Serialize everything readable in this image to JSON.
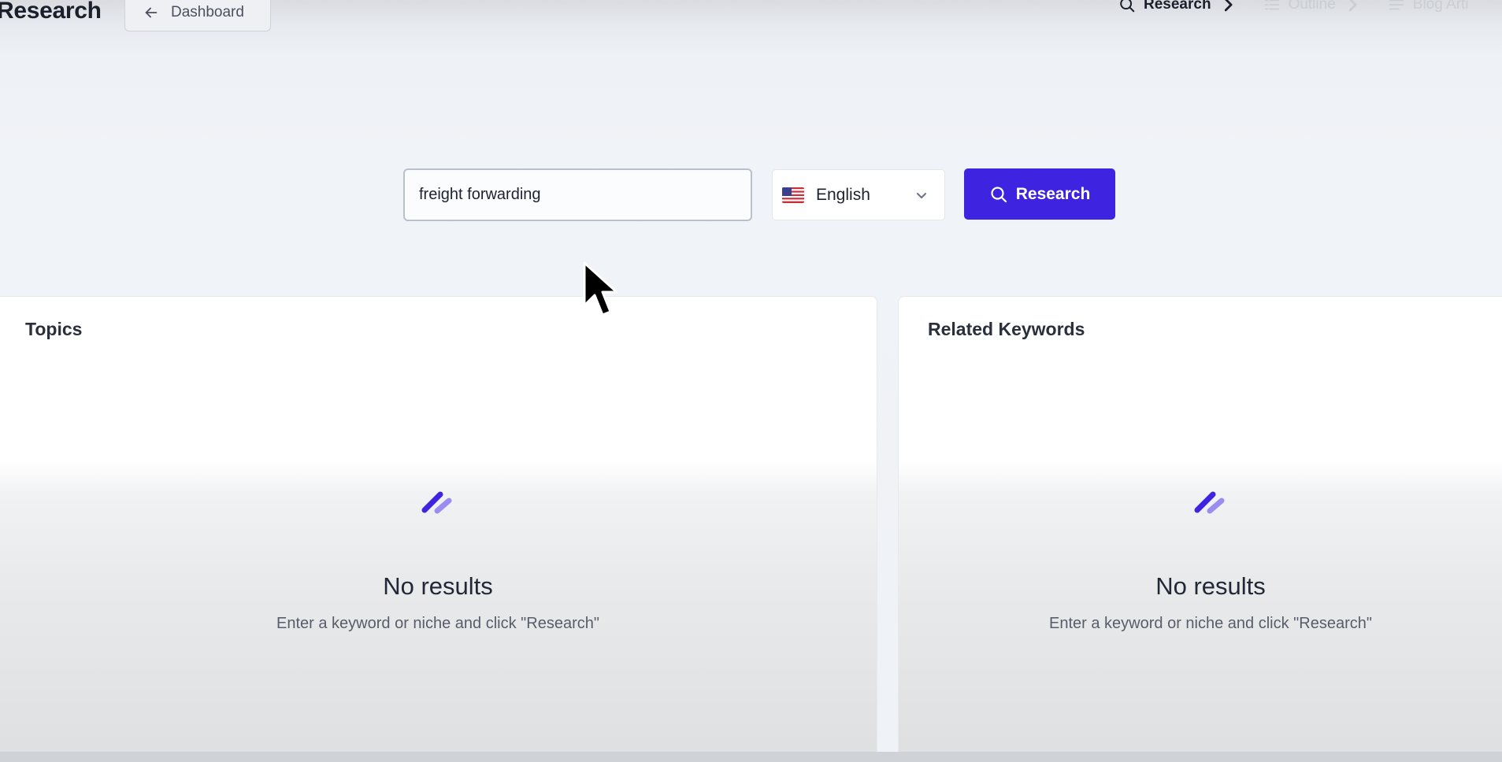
{
  "header": {
    "title": "Research",
    "back_label": "Dashboard",
    "steps": [
      {
        "label": "Research",
        "icon": "search-icon",
        "state": "active"
      },
      {
        "label": "Outline",
        "icon": "list-icon",
        "state": "inactive"
      },
      {
        "label": "Blog Arti",
        "icon": "menu-icon",
        "state": "inactive"
      }
    ]
  },
  "search": {
    "value": "freight forwarding",
    "language": "English",
    "button_label": "Research"
  },
  "panels": {
    "topics": {
      "title": "Topics",
      "empty_title": "No results",
      "empty_subtitle": "Enter a keyword or niche and click \"Research\""
    },
    "keywords": {
      "title": "Related Keywords",
      "empty_title": "No results",
      "empty_subtitle": "Enter a keyword or niche and click \"Research\""
    }
  },
  "colors": {
    "accent": "#3e24e0",
    "icon_light": "#9b8cf0"
  }
}
